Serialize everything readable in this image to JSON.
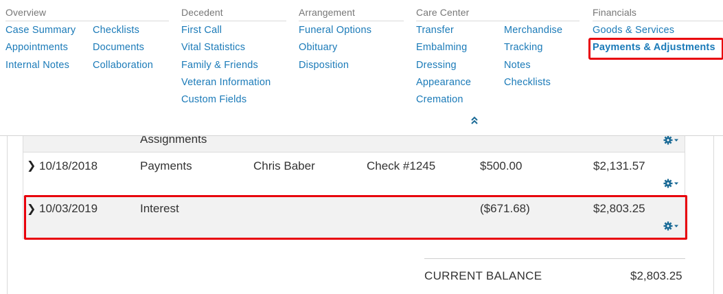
{
  "menu": {
    "overview": {
      "heading": "Overview",
      "col1": [
        "Case Summary",
        "Appointments",
        "Internal Notes"
      ],
      "col2": [
        "Checklists",
        "Documents",
        "Collaboration"
      ]
    },
    "decedent": {
      "heading": "Decedent",
      "items": [
        "First Call",
        "Vital Statistics",
        "Family & Friends",
        "Veteran Information",
        "Custom Fields"
      ]
    },
    "arrangement": {
      "heading": "Arrangement",
      "items": [
        "Funeral Options",
        "Obituary",
        "Disposition"
      ]
    },
    "care_center": {
      "heading": "Care Center",
      "col1": [
        "Transfer",
        "Embalming",
        "Dressing",
        "Appearance",
        "Cremation"
      ],
      "col2": [
        "Merchandise",
        "Tracking",
        "Notes",
        "Checklists"
      ]
    },
    "financials": {
      "heading": "Financials",
      "items": [
        "Goods & Services",
        "Payments & Adjustments"
      ],
      "active_item": "Payments & Adjustments"
    },
    "collapse_icon": "double-chevron-up-icon"
  },
  "ledger": {
    "rows": [
      {
        "type": "Assignments"
      },
      {
        "date": "10/18/2018",
        "type": "Payments",
        "name": "Chris Baber",
        "method": "Check #1245",
        "amount": "$500.00",
        "balance": "$2,131.57"
      },
      {
        "date": "10/03/2019",
        "type": "Interest",
        "name": "",
        "method": "",
        "amount": "($671.68)",
        "balance": "$2,803.25"
      }
    ],
    "current_balance_label": "CURRENT BALANCE",
    "current_balance_value": "$2,803.25"
  },
  "colors": {
    "link": "#1a7ab8",
    "highlight": "#e8000b",
    "gear": "#1a6a96"
  }
}
